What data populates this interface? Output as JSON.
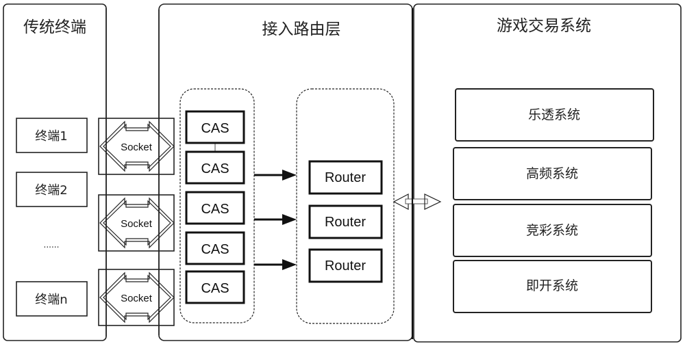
{
  "panels": {
    "terminals": {
      "title": "传统终端",
      "items": [
        "终端1",
        "终端2",
        "......",
        "终端n"
      ]
    },
    "routing_layer": {
      "title": "接入路由层",
      "socket_label": "Socket",
      "cas_nodes": [
        "CAS",
        "CAS",
        "CAS",
        "CAS",
        "CAS"
      ],
      "routers": [
        "Router",
        "Router",
        "Router"
      ]
    },
    "game_trading": {
      "title": "游戏交易系统",
      "systems": [
        "乐透系统",
        "高频系统",
        "竞彩系统",
        "即开系统"
      ]
    }
  },
  "connections": [
    {
      "from": "terminals",
      "to": "cas_group",
      "type": "socket-bidirectional",
      "count": 3
    },
    {
      "from": "cas_group",
      "to": "router_group",
      "type": "directed-arrow",
      "count": 3
    },
    {
      "from": "routing_layer",
      "to": "game_trading",
      "type": "bidirectional-arrow",
      "count": 1
    }
  ]
}
